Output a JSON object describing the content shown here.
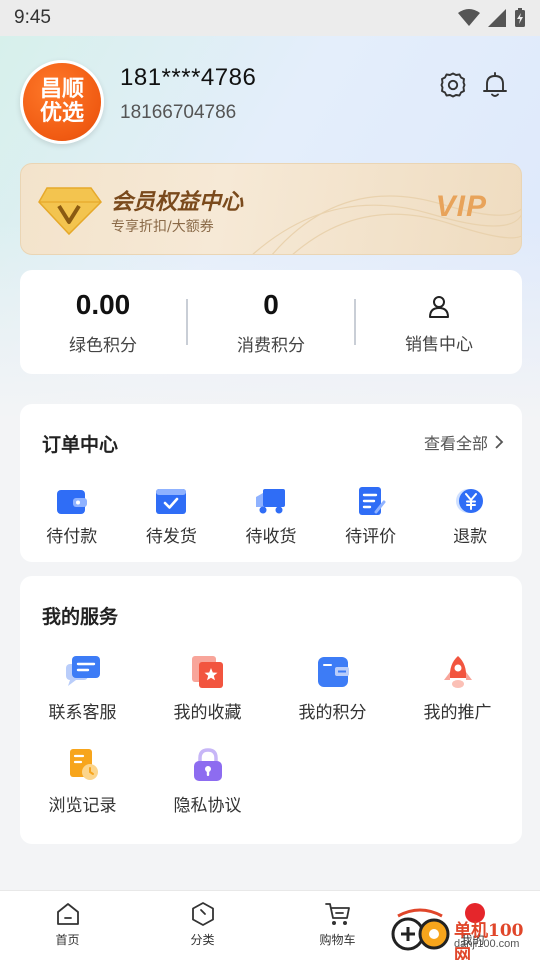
{
  "status_bar": {
    "time": "9:45"
  },
  "profile": {
    "avatar_line1": "昌顺",
    "avatar_line2": "优选",
    "masked_phone": "181****4786",
    "full_phone": "18166704786"
  },
  "vip": {
    "title": "会员权益中心",
    "subtitle": "专享折扣/大额券",
    "tag": "VIP"
  },
  "stats": [
    {
      "value": "0.00",
      "label": "绿色积分"
    },
    {
      "value": "0",
      "label": "消费积分"
    },
    {
      "label": "销售中心"
    }
  ],
  "orders": {
    "title": "订单中心",
    "view_all": "查看全部",
    "items": [
      {
        "label": "待付款",
        "icon": "wallet-icon"
      },
      {
        "label": "待发货",
        "icon": "package-check-icon"
      },
      {
        "label": "待收货",
        "icon": "truck-icon"
      },
      {
        "label": "待评价",
        "icon": "review-doc-icon"
      },
      {
        "label": "退款",
        "icon": "yuan-coin-icon"
      }
    ]
  },
  "services": {
    "title": "我的服务",
    "items": [
      {
        "label": "联系客服",
        "icon": "chat-icon"
      },
      {
        "label": "我的收藏",
        "icon": "favorite-star-icon"
      },
      {
        "label": "我的积分",
        "icon": "points-card-icon"
      },
      {
        "label": "我的推广",
        "icon": "rocket-icon"
      },
      {
        "label": "浏览记录",
        "icon": "history-doc-icon"
      },
      {
        "label": "隐私协议",
        "icon": "lock-icon"
      }
    ]
  },
  "tabbar": [
    {
      "label": "首页",
      "icon": "home-icon"
    },
    {
      "label": "分类",
      "icon": "category-icon"
    },
    {
      "label": "购物车",
      "icon": "cart-icon"
    },
    {
      "label": "我的",
      "icon": "profile-icon"
    }
  ],
  "watermark": {
    "text": "单机100网",
    "url": "danji100.com"
  },
  "colors": {
    "accent_orange": "#f05a12",
    "icon_blue": "#2f6df6",
    "vip_gold": "#e8a35a",
    "badge_red": "#e5262b"
  }
}
